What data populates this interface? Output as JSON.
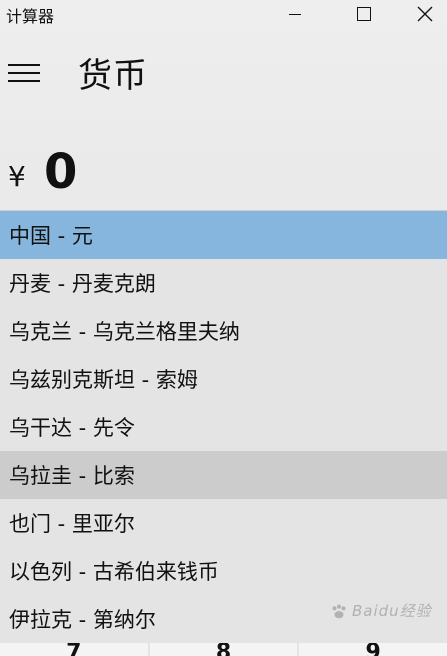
{
  "window": {
    "title": "计算器"
  },
  "header": {
    "title": "货币",
    "menu_icon": "hamburger-menu-icon"
  },
  "display": {
    "currency_symbol": "¥",
    "value": "0"
  },
  "currency_dropdown": {
    "selected": "中国 - 元",
    "hovered": "乌拉圭 - 比索",
    "options": [
      "中国 - 元",
      "丹麦 - 丹麦克朗",
      "乌克兰 - 乌克兰格里夫纳",
      "乌兹别克斯坦 - 索姆",
      "乌干达 - 先令",
      "乌拉圭 - 比索",
      "也门 - 里亚尔",
      "以色列 - 古希伯来钱币",
      "伊拉克 - 第纳尔"
    ]
  },
  "keypad": {
    "visible_keys": [
      "7",
      "8",
      "9"
    ]
  },
  "watermark": {
    "text": "Baidu经验"
  },
  "colors": {
    "selected_bg": "#86b6de",
    "hover_bg": "#cccccc",
    "list_bg": "#e4e4e4"
  }
}
